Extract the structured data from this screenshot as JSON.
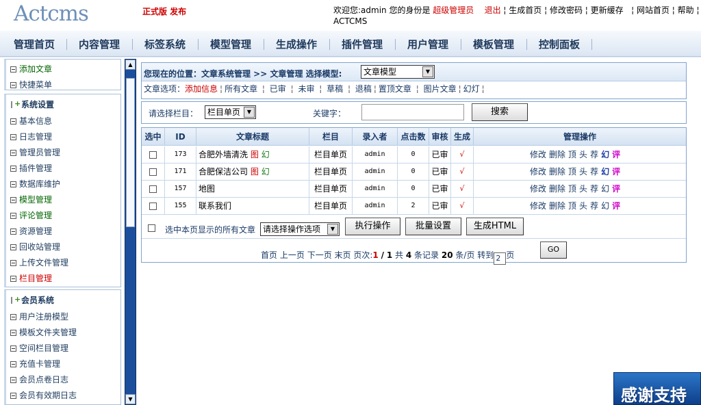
{
  "header": {
    "logo": "Actcms",
    "edition": "正式版 发布",
    "welcome": "欢迎您:admin 您的身份是",
    "role": "超级管理员",
    "logout": "退出",
    "links": [
      "生成首页",
      "修改密码",
      "更新缓存",
      "网站首页",
      "帮助",
      "ACTCMS"
    ]
  },
  "nav": [
    "管理首页",
    "内容管理",
    "标签系统",
    "模型管理",
    "生成操作",
    "插件管理",
    "用户管理",
    "模板管理",
    "控制面板"
  ],
  "sidebar": {
    "box1": [
      "添加文章",
      "快捷菜单"
    ],
    "system_title": "系统设置",
    "system_items": [
      "基本信息",
      "日志管理",
      "管理员管理",
      "插件管理",
      "数据库维护",
      "模型管理",
      "评论管理",
      "资源管理",
      "回收站管理",
      "上传文件管理",
      "栏目管理"
    ],
    "member_title": "会员系统",
    "member_items": [
      "用户注册模型",
      "模板文件夹管理",
      "空间栏目管理",
      "充值卡管理",
      "会员点卷日志",
      "会员有效期日志"
    ]
  },
  "position": {
    "text": "您现在的位置：文章系统管理 >> 文章管理 选择模型:",
    "model_selected": "文章模型",
    "options_label": "文章选项：",
    "options_first": "添加信息",
    "options": [
      "所有文章",
      "已审",
      "未审",
      "草稿",
      "退稿",
      "置顶文章",
      "图片文章",
      "幻灯"
    ]
  },
  "search": {
    "category_label": "请选择栏目：",
    "category_selected": "栏目单页",
    "keyword_label": "关键字：",
    "keyword_value": "",
    "button": "搜索"
  },
  "table": {
    "headers": [
      "选中",
      "ID",
      "文章标题",
      "栏目",
      "录入者",
      "点击数",
      "审核",
      "生成",
      "管理操作"
    ],
    "rows": [
      {
        "id": "173",
        "title": "合肥外墙清洗",
        "tags": [
          "图",
          "幻"
        ],
        "column": "栏目单页",
        "author": "admin",
        "clicks": "0",
        "status": "已审",
        "gen": "√"
      },
      {
        "id": "171",
        "title": "合肥保洁公司",
        "tags": [
          "图",
          "幻"
        ],
        "column": "栏目单页",
        "author": "admin",
        "clicks": "0",
        "status": "已审",
        "gen": "√"
      },
      {
        "id": "157",
        "title": "地图",
        "tags": [],
        "column": "栏目单页",
        "author": "admin",
        "clicks": "0",
        "status": "已审",
        "gen": "√"
      },
      {
        "id": "155",
        "title": "联系我们",
        "tags": [],
        "column": "栏目单页",
        "author": "admin",
        "clicks": "2",
        "status": "已审",
        "gen": "√"
      }
    ],
    "ops": [
      "修改",
      "删除",
      "顶",
      "头",
      "荐",
      "幻",
      "评"
    ]
  },
  "actions": {
    "select_all_label": "选中本页显示的所有文章",
    "op_select": "请选择操作选项",
    "exec": "执行操作",
    "batch": "批量设置",
    "gen_html": "生成HTML"
  },
  "pager": {
    "first": "首页",
    "prev": "上一页",
    "next": "下一页",
    "last": "末页",
    "pages_label": "页次:",
    "current": "1",
    "slash": "/",
    "total_pages": "1",
    "total_label": "共",
    "total_records": "4",
    "records_label": "条记录",
    "per_page": "20",
    "per_page_label": "条/页",
    "goto_label": "转到",
    "goto_value": "2",
    "page_unit": "页",
    "go": "GO"
  },
  "thanks": "感谢支持"
}
